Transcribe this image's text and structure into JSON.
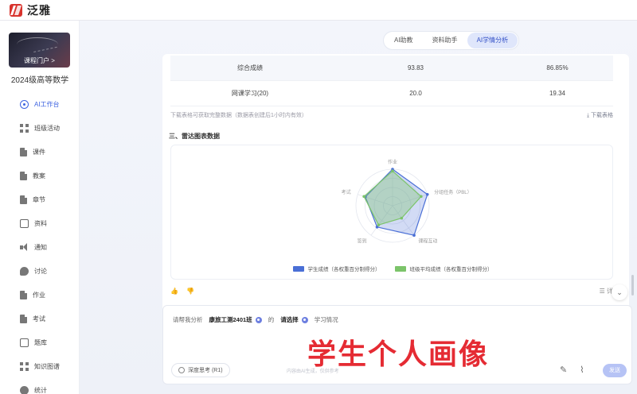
{
  "app": {
    "brand": "泛雅"
  },
  "sidebar": {
    "course_link": "课程门户 >",
    "course_name": "2024级高等数学",
    "items": [
      {
        "label": "AI工作台",
        "icon": "ai-icon",
        "active": true
      },
      {
        "label": "班级活动",
        "icon": "grid-icon"
      },
      {
        "label": "课件",
        "icon": "document-icon"
      },
      {
        "label": "教案",
        "icon": "document-icon"
      },
      {
        "label": "章节",
        "icon": "document-icon"
      },
      {
        "label": "资料",
        "icon": "folder-icon"
      },
      {
        "label": "通知",
        "icon": "speaker-icon"
      },
      {
        "label": "讨论",
        "icon": "chat-icon"
      },
      {
        "label": "作业",
        "icon": "document-icon"
      },
      {
        "label": "考试",
        "icon": "document-icon"
      },
      {
        "label": "题库",
        "icon": "database-icon"
      },
      {
        "label": "知识图谱",
        "icon": "graph-icon"
      },
      {
        "label": "统计",
        "icon": "chart-icon"
      }
    ]
  },
  "tabs": [
    {
      "label": "AI助教"
    },
    {
      "label": "资料助手"
    },
    {
      "label": "AI学情分析",
      "active": true
    }
  ],
  "table": {
    "rows": [
      {
        "name": "综合成绩",
        "a": "93.83",
        "b": "86.85%"
      },
      {
        "name": "网课学习(20)",
        "a": "20.0",
        "b": "19.34"
      }
    ],
    "note": "下载表格可获取完整数据（数据表创建后1小时内有效）",
    "download": "下载表格"
  },
  "section_title": "三、雷达图表数据",
  "chart_data": {
    "type": "radar",
    "axes": [
      "作业",
      "分组任务（PBL）",
      "课程互动",
      "签到",
      "考试"
    ],
    "max": 100,
    "series": [
      {
        "name": "学生成绩（各权重百分制得分）",
        "color": "#4a6fd6",
        "values": [
          100,
          100,
          100,
          72,
          78
        ]
      },
      {
        "name": "班级平均成绩（各权重百分制得分）",
        "color": "#7cc46a",
        "values": [
          95,
          82,
          42,
          65,
          82
        ]
      }
    ]
  },
  "feedback": {
    "like": "👍",
    "dislike": "👎",
    "detail": "详"
  },
  "composer": {
    "prefix": "请帮我分析",
    "class_chip": "康旅工测2401班",
    "middle": "的",
    "select_chip": "请选择",
    "suffix": "学习情况",
    "overlay": "学生个人画像",
    "deep_think": "深度思考 (R1)",
    "send": "发送"
  },
  "footer_hint": "内容由AI生成，仅供参考"
}
